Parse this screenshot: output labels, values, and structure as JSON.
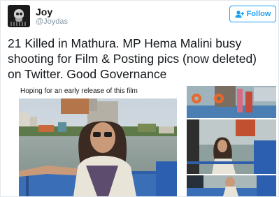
{
  "author": {
    "name": "Joy",
    "handle": "@Joydas"
  },
  "follow_button": {
    "label": "Follow",
    "icon": "add-user-icon"
  },
  "tweet": {
    "lines": [
      "21 Killed in Mathura. MP Hema Malini busy",
      "shooting for Film & Posting pics (now deleted)",
      "on Twitter. Good Governance"
    ]
  },
  "embedded_post": {
    "caption": "Hoping for an early release of this film"
  },
  "colors": {
    "accent": "#1da1f2",
    "text": "#14171a",
    "muted": "#8899a6"
  }
}
